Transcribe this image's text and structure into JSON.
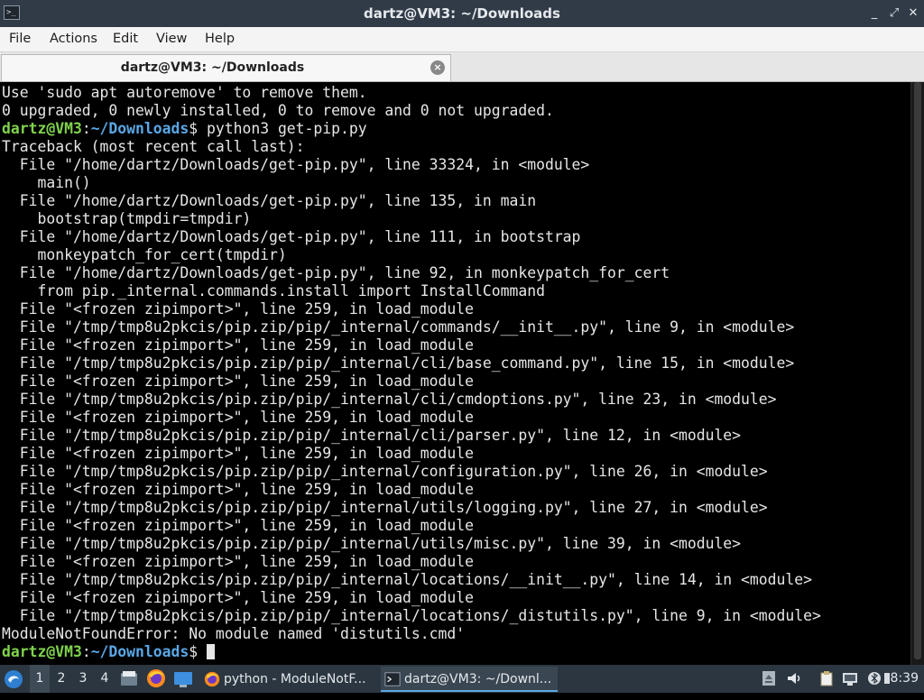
{
  "window": {
    "title": "dartz@VM3: ~/Downloads",
    "controls": {
      "minimize": "_",
      "maximize": "⤢",
      "close": "✕"
    }
  },
  "menu": [
    "File",
    "Actions",
    "Edit",
    "View",
    "Help"
  ],
  "tab": {
    "label": "dartz@VM3: ~/Downloads",
    "close_icon": "×"
  },
  "terminal": {
    "prompt_user": "dartz@VM3",
    "prompt_path": "~/Downloads",
    "lines_before": [
      "Use 'sudo apt autoremove' to remove them.",
      "0 upgraded, 0 newly installed, 0 to remove and 0 not upgraded."
    ],
    "command": "python3 get-pip.py",
    "output": [
      "Traceback (most recent call last):",
      "  File \"/home/dartz/Downloads/get-pip.py\", line 33324, in <module>",
      "    main()",
      "  File \"/home/dartz/Downloads/get-pip.py\", line 135, in main",
      "    bootstrap(tmpdir=tmpdir)",
      "  File \"/home/dartz/Downloads/get-pip.py\", line 111, in bootstrap",
      "    monkeypatch_for_cert(tmpdir)",
      "  File \"/home/dartz/Downloads/get-pip.py\", line 92, in monkeypatch_for_cert",
      "    from pip._internal.commands.install import InstallCommand",
      "  File \"<frozen zipimport>\", line 259, in load_module",
      "  File \"/tmp/tmp8u2pkcis/pip.zip/pip/_internal/commands/__init__.py\", line 9, in <module>",
      "  File \"<frozen zipimport>\", line 259, in load_module",
      "  File \"/tmp/tmp8u2pkcis/pip.zip/pip/_internal/cli/base_command.py\", line 15, in <module>",
      "  File \"<frozen zipimport>\", line 259, in load_module",
      "  File \"/tmp/tmp8u2pkcis/pip.zip/pip/_internal/cli/cmdoptions.py\", line 23, in <module>",
      "  File \"<frozen zipimport>\", line 259, in load_module",
      "  File \"/tmp/tmp8u2pkcis/pip.zip/pip/_internal/cli/parser.py\", line 12, in <module>",
      "  File \"<frozen zipimport>\", line 259, in load_module",
      "  File \"/tmp/tmp8u2pkcis/pip.zip/pip/_internal/configuration.py\", line 26, in <module>",
      "  File \"<frozen zipimport>\", line 259, in load_module",
      "  File \"/tmp/tmp8u2pkcis/pip.zip/pip/_internal/utils/logging.py\", line 27, in <module>",
      "  File \"<frozen zipimport>\", line 259, in load_module",
      "  File \"/tmp/tmp8u2pkcis/pip.zip/pip/_internal/utils/misc.py\", line 39, in <module>",
      "  File \"<frozen zipimport>\", line 259, in load_module",
      "  File \"/tmp/tmp8u2pkcis/pip.zip/pip/_internal/locations/__init__.py\", line 14, in <module>",
      "  File \"<frozen zipimport>\", line 259, in load_module",
      "  File \"/tmp/tmp8u2pkcis/pip.zip/pip/_internal/locations/_distutils.py\", line 9, in <module>",
      "ModuleNotFoundError: No module named 'distutils.cmd'"
    ],
    "colors": {
      "user": "#7fd34c",
      "path": "#5aa7e6",
      "text": "#e6e6e6",
      "background": "#000000"
    }
  },
  "taskbar": {
    "workspaces": [
      "1",
      "2",
      "3",
      "4"
    ],
    "active_workspace": "1",
    "launchers": [
      "start-menu-icon",
      "file-manager-icon",
      "firefox-icon",
      "desktop-icon"
    ],
    "tasks": [
      {
        "label": "python - ModuleNotF...",
        "icon": "firefox-icon",
        "active": false
      },
      {
        "label": "dartz@VM3: ~/Downl...",
        "icon": "terminal-icon",
        "active": true
      }
    ],
    "tray": [
      "eject-icon",
      "volume-icon",
      "clipboard-icon",
      "network-icon",
      "bluetooth-icon",
      "power-icon"
    ],
    "clock": "8:39"
  }
}
